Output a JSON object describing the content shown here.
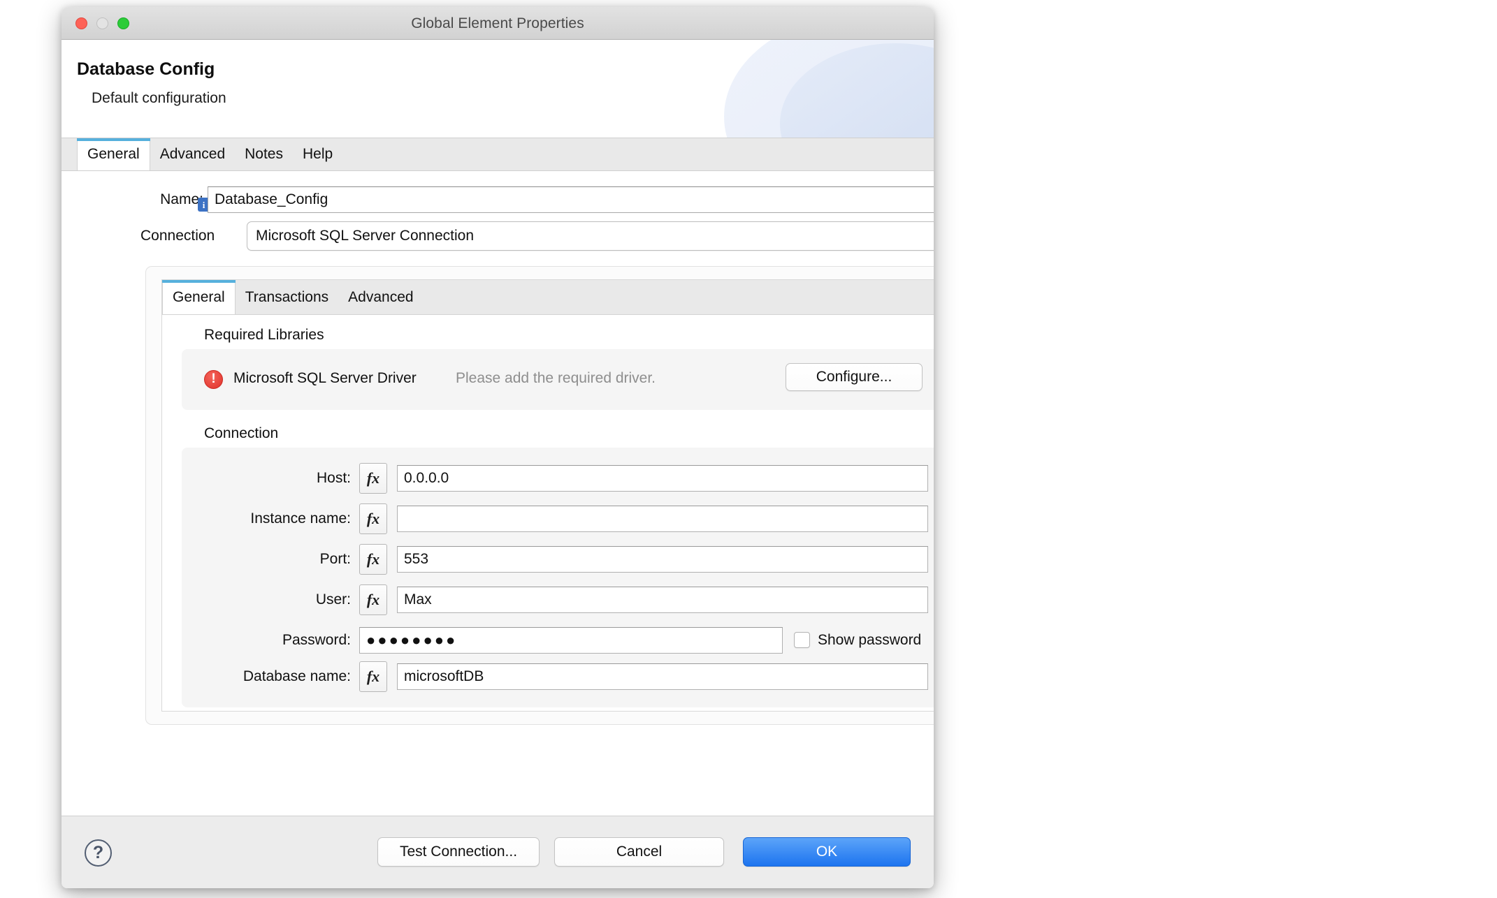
{
  "window": {
    "title": "Global Element Properties",
    "controls": {
      "close": "close-button",
      "minimize": "minimize-button",
      "maximize": "maximize-button"
    }
  },
  "header": {
    "title": "Database Config",
    "subtitle": "Default configuration"
  },
  "outer_tabs": [
    {
      "label": "General",
      "active": true
    },
    {
      "label": "Advanced",
      "active": false
    },
    {
      "label": "Notes",
      "active": false
    },
    {
      "label": "Help",
      "active": false
    }
  ],
  "name_field": {
    "label": "Name:",
    "info_icon": "i",
    "value": "Database_Config"
  },
  "connection_field": {
    "label": "Connection",
    "value": "Microsoft SQL Server Connection"
  },
  "inner_tabs": [
    {
      "label": "General",
      "active": true
    },
    {
      "label": "Transactions",
      "active": false
    },
    {
      "label": "Advanced",
      "active": false
    }
  ],
  "required_libraries": {
    "group_label": "Required Libraries",
    "driver_name": "Microsoft SQL Server Driver",
    "status_text": "Please add the required driver.",
    "configure_label": "Configure..."
  },
  "connection_group": {
    "group_label": "Connection",
    "fields": [
      {
        "label": "Host:",
        "value": "0.0.0.0",
        "fx": "fx"
      },
      {
        "label": "Instance name:",
        "value": "",
        "fx": "fx"
      },
      {
        "label": "Port:",
        "value": "553",
        "fx": "fx"
      },
      {
        "label": "User:",
        "value": "Max",
        "fx": "fx"
      },
      {
        "label": "Password:",
        "value": "●●●●●●●●"
      },
      {
        "label": "Database name:",
        "value": "microsoftDB",
        "fx": "fx"
      }
    ],
    "show_password_label": "Show password",
    "show_password_checked": false
  },
  "footer": {
    "help_glyph": "?",
    "test_label": "Test Connection...",
    "cancel_label": "Cancel",
    "ok_label": "OK"
  },
  "colors": {
    "accent_tab": "#56b0dd",
    "primary_button": "#1d74ef",
    "error": "#e0312a",
    "info_badge": "#3c72c4",
    "muted_text": "#8e8e8e"
  }
}
